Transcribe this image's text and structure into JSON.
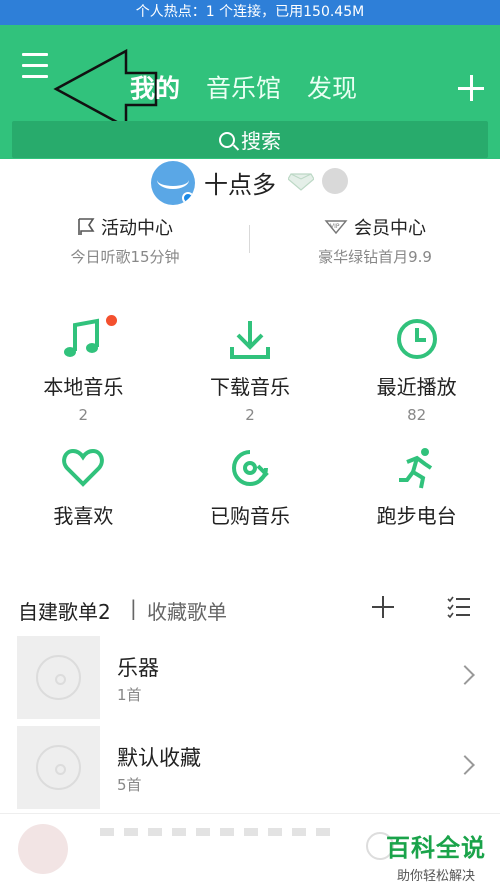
{
  "status_bar": {
    "text": "个人热点：1 个连接，已用150.45M"
  },
  "header": {
    "tabs": [
      {
        "label": "我的",
        "active": true
      },
      {
        "label": "音乐馆",
        "active": false
      },
      {
        "label": "发现",
        "active": false
      }
    ],
    "search_label": "搜索"
  },
  "profile": {
    "username": "十点多"
  },
  "activity": [
    {
      "title": "活动中心",
      "subtitle": "今日听歌15分钟",
      "icon": "flag-icon"
    },
    {
      "title": "会员中心",
      "subtitle": "豪华绿钻首月9.9",
      "icon": "vip-icon"
    }
  ],
  "grid": [
    {
      "label": "本地音乐",
      "count": "2",
      "icon": "music-note-icon"
    },
    {
      "label": "下载音乐",
      "count": "2",
      "icon": "download-icon"
    },
    {
      "label": "最近播放",
      "count": "82",
      "icon": "clock-icon"
    },
    {
      "label": "我喜欢",
      "count": "",
      "icon": "heart-icon"
    },
    {
      "label": "已购音乐",
      "count": "",
      "icon": "purchased-disc-icon"
    },
    {
      "label": "跑步电台",
      "count": "",
      "icon": "running-icon"
    }
  ],
  "playlists": {
    "tab_created": "自建歌单2",
    "separator": "|",
    "tab_collected": "收藏歌单",
    "items": [
      {
        "name": "乐器",
        "count": "1首"
      },
      {
        "name": "默认收藏",
        "count": "5首"
      }
    ]
  },
  "watermark": {
    "title": "百科全说",
    "subtitle": "助你轻松解决"
  },
  "colors": {
    "primary_green": "#31c27c",
    "status_blue": "#2e7fd8",
    "notify_red": "#f4502e"
  }
}
